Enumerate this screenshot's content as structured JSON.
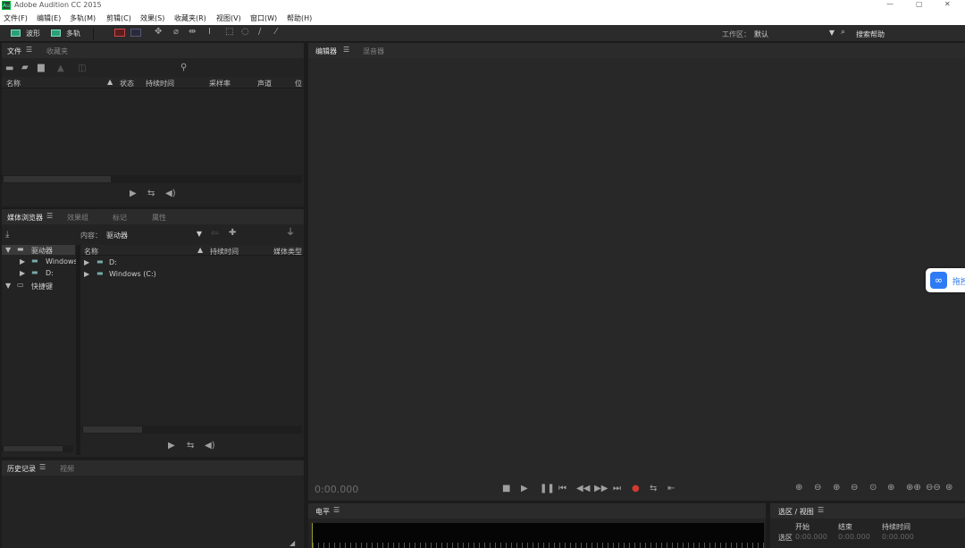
{
  "app": {
    "title": "Adobe Audition CC 2015",
    "logo": "Au"
  },
  "menu": [
    "文件(F)",
    "编辑(E)",
    "多轨(M)",
    "剪辑(C)",
    "效果(S)",
    "收藏夹(R)",
    "视图(V)",
    "窗口(W)",
    "帮助(H)"
  ],
  "toolbar": {
    "waveform": "波形",
    "multitrack": "多轨",
    "workspace_label": "工作区：",
    "workspace_value": "默认",
    "search_help": "搜索帮助"
  },
  "files_panel": {
    "tab_files": "文件",
    "tab_favorites": "收藏夹",
    "columns": [
      "名称",
      "状态",
      "持续时间",
      "采样率",
      "声道",
      "位"
    ]
  },
  "media_panel": {
    "tabs": [
      "媒体浏览器",
      "效果组",
      "标记",
      "属性"
    ],
    "content_label": "内容：",
    "content_value": "驱动器",
    "tree": [
      {
        "label": "驱动器"
      },
      {
        "label": "Windows"
      },
      {
        "label": "D:"
      },
      {
        "label": "快捷键"
      }
    ],
    "columns": [
      "名称",
      "持续时间",
      "媒体类型"
    ],
    "rows": [
      "D:",
      "Windows (C:)"
    ]
  },
  "history_panel": {
    "tab_history": "历史记录",
    "tab_video": "视频"
  },
  "editor_panel": {
    "tab_editor": "编辑器",
    "tab_mixer": "混音器",
    "time": "0:00.000"
  },
  "level_panel": {
    "tab": "电平"
  },
  "selection_panel": {
    "tab": "选区 / 视图",
    "cols": [
      "开始",
      "结束",
      "持续时间"
    ],
    "row_label": "选区",
    "values": [
      "0:00.000",
      "0:00.000",
      "0:00.000"
    ]
  },
  "baidu": {
    "label": "拖拽"
  },
  "colors": {
    "accent_waveform": "#2aa07a",
    "record_red": "#d23b2e",
    "baidu_blue": "#2f7bf5"
  },
  "icons": [
    "minimize-icon",
    "maximize-icon",
    "close-icon",
    "search-icon",
    "play-icon",
    "stop-icon",
    "pause-icon",
    "record-icon",
    "zoom-in-icon"
  ]
}
